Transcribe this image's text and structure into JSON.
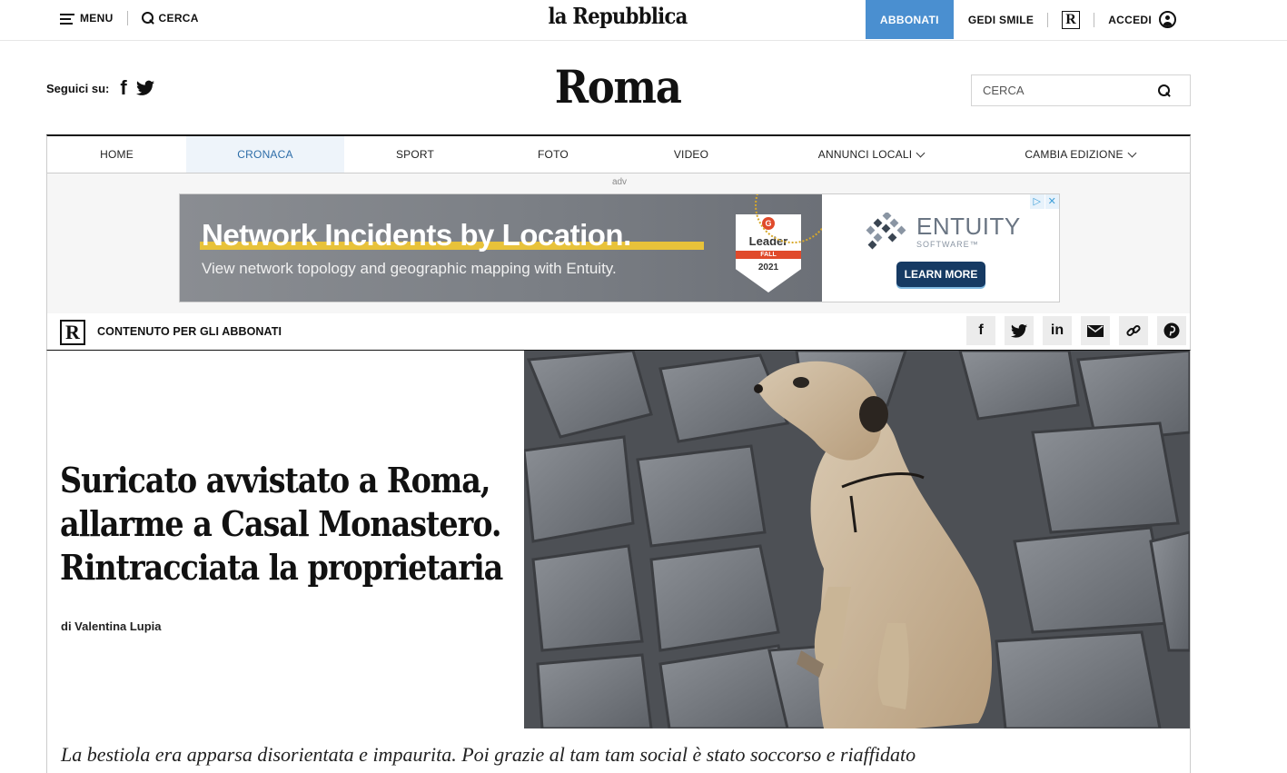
{
  "topbar": {
    "menu_label": "MENU",
    "search_label": "CERCA",
    "brand": "la Repubblica",
    "subscribe_label": "ABBONATI",
    "gedi_label": "GEDI SMILE",
    "r_logo": "R",
    "login_label": "ACCEDI"
  },
  "header": {
    "follow_label": "Seguici su:",
    "facebook_glyph": "f",
    "section_title": "Roma",
    "search_placeholder": "CERCA"
  },
  "nav": {
    "items": [
      {
        "label": "HOME"
      },
      {
        "label": "CRONACA",
        "active": true
      },
      {
        "label": "SPORT"
      },
      {
        "label": "FOTO"
      },
      {
        "label": "VIDEO"
      },
      {
        "label": "ANNUNCI LOCALI",
        "dropdown": true
      },
      {
        "label": "CAMBIA EDIZIONE",
        "dropdown": true
      }
    ]
  },
  "ad": {
    "label": "adv",
    "headline": "Network Incidents by Location.",
    "subline": "View network topology and geographic mapping with Entuity.",
    "badge_leader": "Leader",
    "badge_season": "FALL",
    "badge_year": "2021",
    "badge_g": "G",
    "brand_name": "ENTUITY",
    "brand_sub": "SOFTWARE™",
    "cta": "LEARN MORE",
    "choices_icon": "▷",
    "close_icon": "✕"
  },
  "subscriber_bar": {
    "logo": "R",
    "label": "CONTENUTO PER GLI ABBONATI",
    "share_icons": [
      "facebook-icon",
      "twitter-icon",
      "linkedin-icon",
      "mail-icon",
      "link-icon",
      "pinterest-icon"
    ],
    "share_glyphs": {
      "facebook": "f",
      "linkedin": "in"
    }
  },
  "article": {
    "headline_lines": [
      "Suricato avvistato a Roma,",
      "allarme a Casal Monastero.",
      "Rintracciata la proprietaria"
    ],
    "byline": "di Valentina Lupia",
    "summary": "La bestiola era apparsa disorientata e impaurita. Poi grazie al tam tam social è stato soccorso e riaffidato"
  },
  "colors": {
    "subscribe_bg": "#4a8fd0",
    "nav_active_text": "#2d6da8",
    "ad_highlight": "#e8c23a",
    "ad_cta_bg": "#163a63",
    "badge_red": "#e04a2b"
  }
}
